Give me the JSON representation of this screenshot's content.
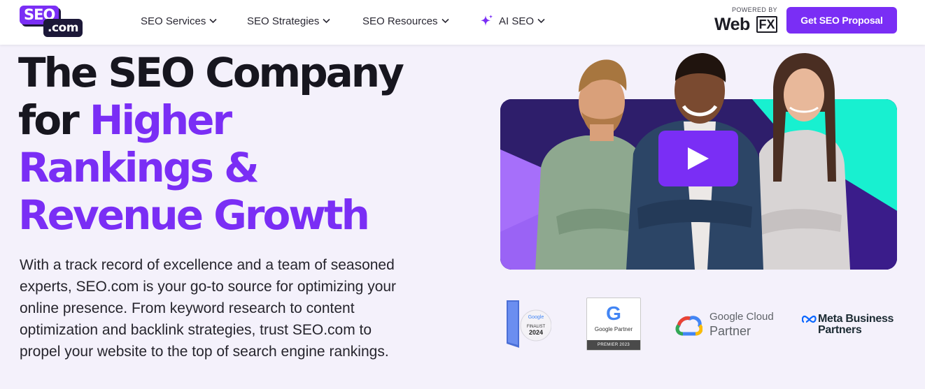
{
  "header": {
    "logo": {
      "top": "SEO",
      "bottom": ".com"
    },
    "nav": [
      {
        "label": "SEO Services"
      },
      {
        "label": "SEO Strategies"
      },
      {
        "label": "SEO Resources"
      },
      {
        "label": "AI SEO"
      }
    ],
    "powered_by": {
      "label": "POWERED BY",
      "brand_web": "Web",
      "brand_fx": "FX"
    },
    "cta_label": "Get SEO Proposal"
  },
  "hero": {
    "headline": {
      "line1": "The SEO Company",
      "line2_plain": "for ",
      "line2_accent": "Higher",
      "line3": "Rankings &",
      "line4": "Revenue Growth"
    },
    "description": "With a track record of excellence and a team of seasoned experts, SEO.com is your go-to source for optimizing your online presence. From keyword research to content optimization and backlink strategies, trust SEO.com to propel your website to the top of search engine rankings."
  },
  "video": {
    "play_icon": "play-icon"
  },
  "badges": {
    "award": {
      "brand": "Google",
      "status": "FINALIST",
      "year": "2024"
    },
    "google_partner": {
      "logo_letter": "G",
      "label": "Google Partner",
      "tier": "PREMIER 2023"
    },
    "google_cloud": {
      "line1": "Google Cloud",
      "line2": "Partner"
    },
    "meta": {
      "line1": "Meta Business",
      "line2": "Partners"
    }
  },
  "colors": {
    "brand_purple": "#7a2ef5",
    "dark_navy": "#1c1838",
    "page_bg": "#f4f1fb",
    "teal": "#18f0d0"
  }
}
